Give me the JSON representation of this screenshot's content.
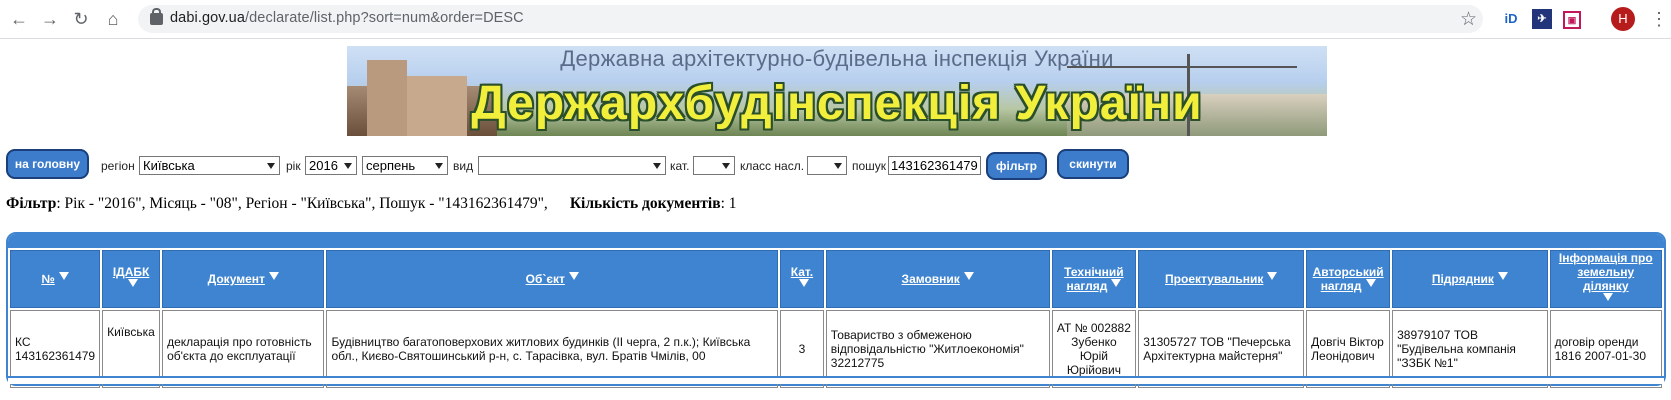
{
  "browser": {
    "url_host": "dabi.gov.ua",
    "url_path": "/declarate/list.php?sort=num&order=DESC",
    "avatar_letter": "Н"
  },
  "banner": {
    "subtitle": "Державна архітектурно-будівельна інспекція України",
    "title": "Держархбудінспекція України"
  },
  "form": {
    "home_button": "на головну",
    "region_label": "регіон",
    "region_value": "Київська",
    "year_label": "рік",
    "year_value": "2016",
    "month_value": "серпень",
    "type_label": "вид",
    "type_value": "",
    "category_label": "кат.",
    "category_value": "",
    "class_label": "класс насл.",
    "class_value": "",
    "search_label": "пошук",
    "search_value": "143162361479",
    "filter_button": "фільтр",
    "reset_button": "скинути"
  },
  "filter_summary": {
    "label": "Фільтр",
    "text": ": Рік - \"2016\", Місяць - \"08\", Регіон - \"Київська\", Пошук - \"143162361479\",",
    "count_label": "Кількість документів",
    "count_value": ": 1"
  },
  "table": {
    "headers": [
      "№",
      "ІДАБК",
      "Документ",
      "Об`єкт",
      "Кат.",
      "Замовник",
      "Технічний нагляд",
      "Проектувальник",
      "Авторський нагляд",
      "Підрядник",
      "Інформація про земельну ділянку"
    ],
    "rows": [
      {
        "num": "КС 143162361479",
        "idabk": "Київська",
        "document": "декларація про готовність об'єкта до експлуатації",
        "object": "Будівництво багатоповерхових житлових будинків (ІІ черга, 2 п.к.); Київська обл., Києво-Святошинський р-н, с. Тарасівка, вул. Братів Чмілів, 00",
        "cat": "3",
        "customer": "Товариство з обмеженою відповідальністю \"Житлоекономія\" 32212775",
        "tech_supervision": "АТ № 002882 Зубенко Юрій Юрійович",
        "designer": "31305727 ТОВ \"Печерська Архітектурна майстерня\"",
        "author_supervision": "Довгіч Віктор Леонідович",
        "contractor": "38979107 ТОВ \"Будівельна компанія \"ЗЗБК №1\"",
        "land_info": "договір оренди 1816 2007-01-30"
      }
    ]
  },
  "colors": {
    "accent": "#3f84d0",
    "button": "#3c7ccb",
    "banner_title": "#f2ee3c"
  }
}
